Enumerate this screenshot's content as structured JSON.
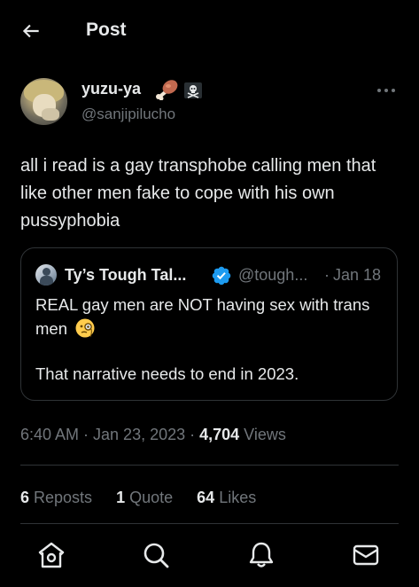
{
  "header": {
    "title": "Post"
  },
  "author": {
    "display_name": "yuzu-ya",
    "name_emojis": [
      "meat-on-bone",
      "pirate-flag"
    ],
    "handle": "@sanjipilucho"
  },
  "post": {
    "text": "all i read is a gay transphobe calling men that like other men fake to cope with his own pussyphobia"
  },
  "quote": {
    "display_name": "Ty’s Tough Tal...",
    "verified": true,
    "handle": "@tough...",
    "separator": "·",
    "date": "Jan 18",
    "text_line1": "REAL gay men are NOT having sex with trans men",
    "text_emoji": "face-with-monocle",
    "text_line2": "That narrative needs to end in 2023."
  },
  "meta": {
    "time_date": "6:40 AM · Jan 23, 2023 · ",
    "views_count": "4,704",
    "views_label": " Views"
  },
  "stats": [
    {
      "count": "6",
      "label": " Reposts"
    },
    {
      "count": "1",
      "label": " Quote"
    },
    {
      "count": "64",
      "label": " Likes"
    }
  ],
  "nav": [
    "home-icon",
    "search-icon",
    "notifications-bell-icon",
    "messages-mail-icon"
  ],
  "colors": {
    "background": "#000000",
    "text_primary": "#e7e9ea",
    "text_secondary": "#71767b",
    "border": "#2f3336",
    "verified_blue": "#1d9bf0"
  }
}
